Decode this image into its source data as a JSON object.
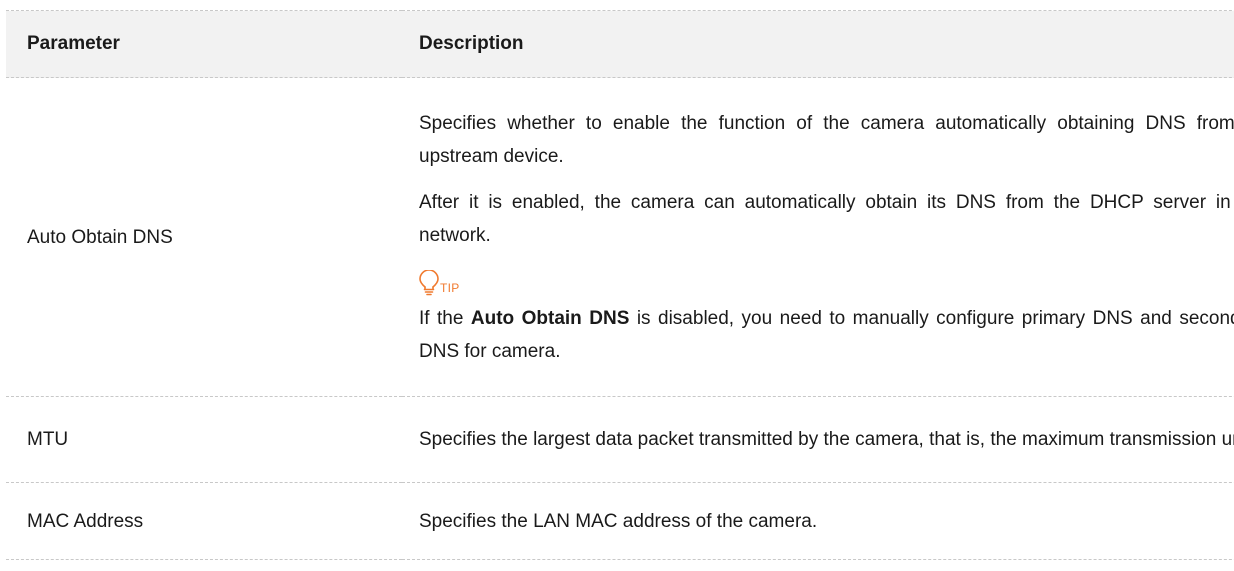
{
  "table": {
    "headers": {
      "parameter": "Parameter",
      "description": "Description"
    },
    "rows": [
      {
        "parameter": "Auto Obtain DNS",
        "desc_1": "Specifies whether to enable the function of the camera automatically obtaining DNS from an upstream device.",
        "desc_2": "After it is enabled, the camera can automatically obtain its DNS from the DHCP server in the network.",
        "tip_label": "TIP",
        "tip_icon": "lightbulb-icon",
        "tip_color": "#f07a2f",
        "tip_text_before": "If the ",
        "tip_text_bold": "Auto Obtain DNS",
        "tip_text_after": " is disabled, you need to manually configure primary DNS and secondary DNS for camera."
      },
      {
        "parameter": "MTU",
        "desc_1": "Specifies the largest data packet transmitted by the camera, that is, the maximum transmission unit."
      },
      {
        "parameter": "MAC Address",
        "desc_1": "Specifies the LAN MAC address of the camera."
      }
    ]
  },
  "colors": {
    "header_bg": "#f2f2f2",
    "divider": "#c8c8c8",
    "tip_accent": "#f07a2f"
  }
}
